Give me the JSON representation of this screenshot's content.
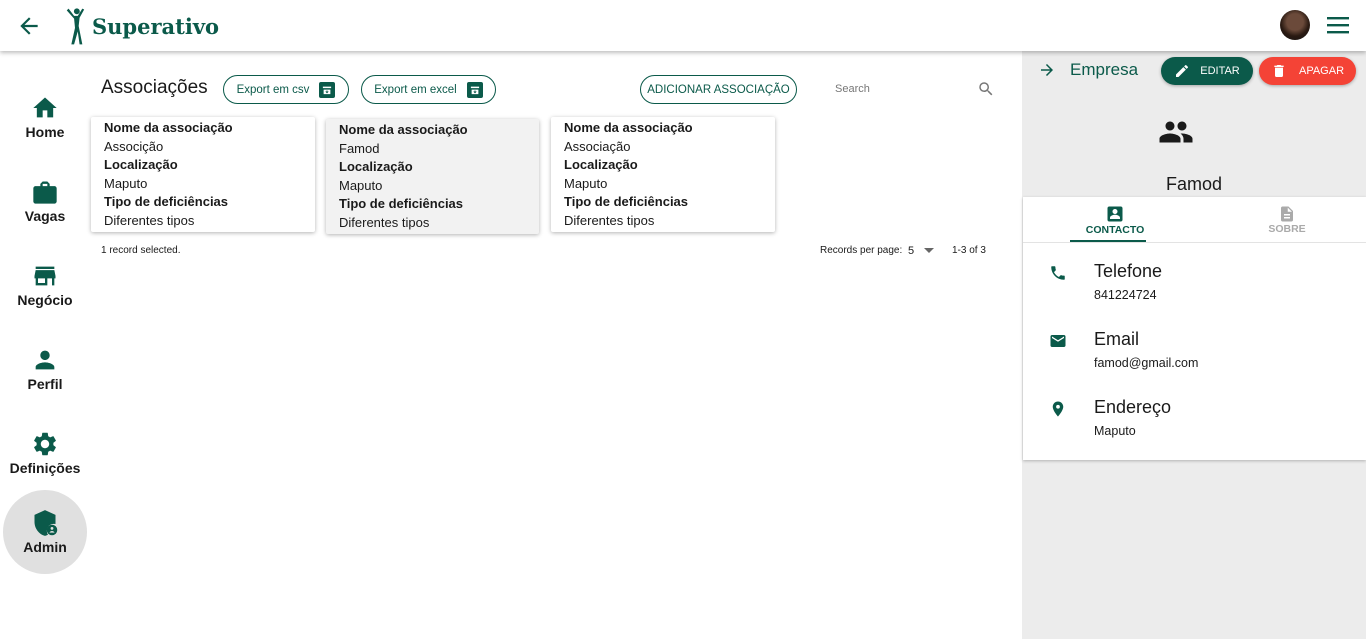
{
  "app": {
    "name": "Superativo",
    "primary_color": "#0b5a4a",
    "danger_color": "#f44336"
  },
  "topbar": {
    "back_icon": "arrow-left-icon",
    "menu_icon": "hamburger-menu-icon"
  },
  "sidebar": {
    "items": [
      {
        "label": "Home",
        "icon": "home-icon",
        "active": false
      },
      {
        "label": "Vagas",
        "icon": "briefcase-icon",
        "active": false
      },
      {
        "label": "Negócio",
        "icon": "store-icon",
        "active": false
      },
      {
        "label": "Perfil",
        "icon": "person-icon",
        "active": false
      },
      {
        "label": "Definições",
        "icon": "gear-icon",
        "active": false
      },
      {
        "label": "Admin",
        "icon": "admin-shield-icon",
        "active": true
      }
    ]
  },
  "main": {
    "title": "Associações",
    "export_csv": "Export em csv",
    "export_excel": "Export em excel",
    "add_button": "ADICIONAR ASSOCIAÇÃO",
    "search_placeholder": "Search",
    "field_labels": {
      "name": "Nome da associação",
      "location": "Localização",
      "type": "Tipo de deficiências"
    },
    "records": [
      {
        "name": "Associção",
        "location": "Maputo",
        "type": "Diferentes tipos",
        "selected": false
      },
      {
        "name": "Famod",
        "location": "Maputo",
        "type": "Diferentes tipos",
        "selected": true
      },
      {
        "name": "Associação",
        "location": "Maputo",
        "type": "Diferentes tipos",
        "selected": false
      }
    ],
    "footer": {
      "selected_text": "1 record selected.",
      "rows_per_page_label": "Records per page:",
      "rows_per_page": "5",
      "range": "1-3 of 3"
    }
  },
  "panel": {
    "nav_label": "Empresa",
    "edit_button": "EDITAR",
    "delete_button": "APAGAR",
    "entity_name": "Famod",
    "tabs": [
      {
        "label": "CONTACTO",
        "icon": "contact-card-icon",
        "active": true
      },
      {
        "label": "SOBRE",
        "icon": "document-icon",
        "active": false
      }
    ],
    "contact": [
      {
        "title": "Telefone",
        "value": "841224724",
        "icon": "phone-icon"
      },
      {
        "title": "Email",
        "value": "famod@gmail.com",
        "icon": "mail-icon"
      },
      {
        "title": "Endereço",
        "value": "Maputo",
        "icon": "location-pin-icon"
      }
    ]
  }
}
